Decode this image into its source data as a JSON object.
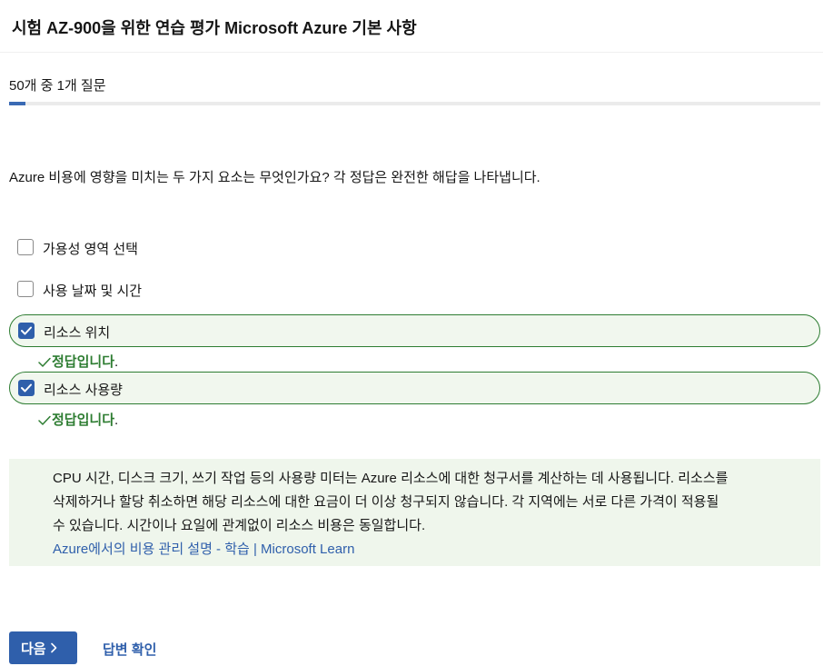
{
  "header": {
    "title": "시험 AZ-900을 위한 연습 평가 Microsoft Azure 기본 사항"
  },
  "progress": {
    "label": "50개 중 1개 질문",
    "current": 1,
    "total": 50
  },
  "question": {
    "text": "Azure 비용에 영향을 미치는 두 가지 요소는 무엇인가요? 각 정답은 완전한 해답을 나타냅니다."
  },
  "options": [
    {
      "label": "가용성 영역 선택",
      "checked": false,
      "correct": false
    },
    {
      "label": "사용 날짜 및 시간",
      "checked": false,
      "correct": false
    },
    {
      "label": "리소스 위치",
      "checked": true,
      "correct": true,
      "feedback": "정답입니다",
      "feedback_suffix": "."
    },
    {
      "label": "리소스 사용량",
      "checked": true,
      "correct": true,
      "feedback": "정답입니다",
      "feedback_suffix": "."
    }
  ],
  "explanation": {
    "line1": "CPU 시간, 디스크 크기, 쓰기 작업 등의 사용량 미터는 Azure 리소스에 대한 청구서를 계산하는 데 사용됩니다. 리소스를",
    "line2": "삭제하거나 할당 취소하면 해당 리소스에 대한 요금이 더 이상 청구되지 않습니다. 각 지역에는 서로 다른 가격이 적용될",
    "line3": "수 있습니다. 시간이나 요일에 관계없이 리소스 비용은 동일합니다.",
    "link": "Azure에서의 비용 관리 설명 - 학습 | Microsoft Learn"
  },
  "actions": {
    "next_label": "다음",
    "check_label": "답변 확인"
  },
  "colors": {
    "accent": "#2f5fab",
    "correct": "#2e7d32",
    "correct_bg": "#f1f7ee",
    "explanation_bg": "#eff6ec"
  },
  "icons": {
    "checkbox_checked": "checkmark-icon",
    "feedback": "check-icon",
    "next": "chevron-right-icon"
  }
}
